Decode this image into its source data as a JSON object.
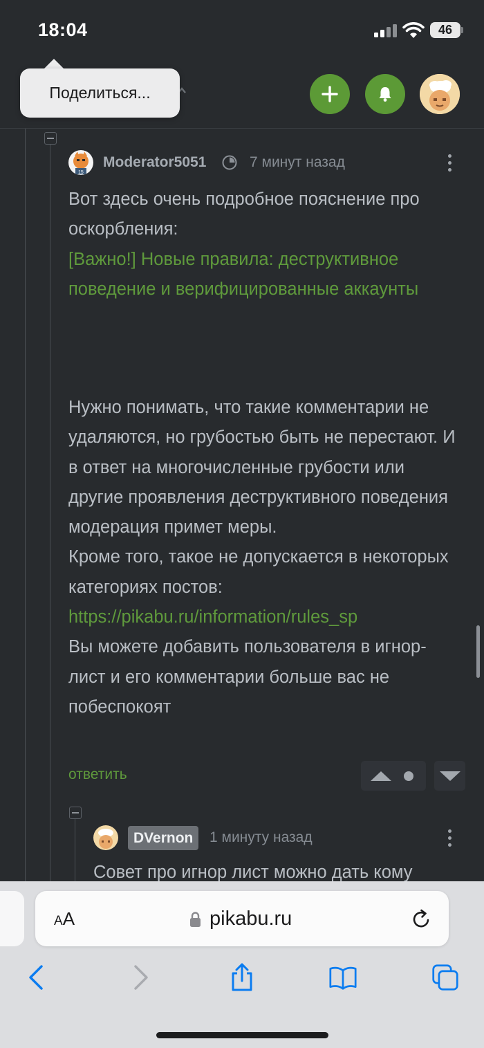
{
  "status_bar": {
    "time": "18:04",
    "battery": "46"
  },
  "tooltip": {
    "label": "Поделиться..."
  },
  "header": {
    "add_icon": "plus-icon",
    "notifications_icon": "bell-icon",
    "accent_color": "#5c9a36"
  },
  "comment": {
    "username": "Moderator5051",
    "time": "7 минут назад",
    "text_intro": "Вот здесь очень подробное пояснение про оскорбления:",
    "rules_link": "[Важно!] Новые правила: деструктивное поведение и верифицированные аккаунты",
    "text_main": "Нужно понимать, что такие комментарии не удаляются, но грубостью быть не перестают. И в ответ на многочисленные грубости или другие проявления деструктивного поведения модерация примет меры.",
    "text_categories": "Кроме того, такое не допускается в некоторых категориях постов:",
    "url_link": "https://pikabu.ru/information/rules_sp",
    "text_ignore": "Вы можете добавить пользователя в игнор-лист и его комментарии больше вас не побеспокоят",
    "reply_label": "ответить",
    "link_color": "#5f9a3c"
  },
  "reply_comment": {
    "username": "DVernon",
    "time": "1 минуту назад",
    "text_preview": "Совет про игнор лист можно дать кому"
  },
  "browser": {
    "text_size_label": "AA",
    "url": "pikabu.ru",
    "icons": [
      "back-icon",
      "forward-icon",
      "share-icon",
      "bookmarks-icon",
      "tabs-icon"
    ]
  }
}
